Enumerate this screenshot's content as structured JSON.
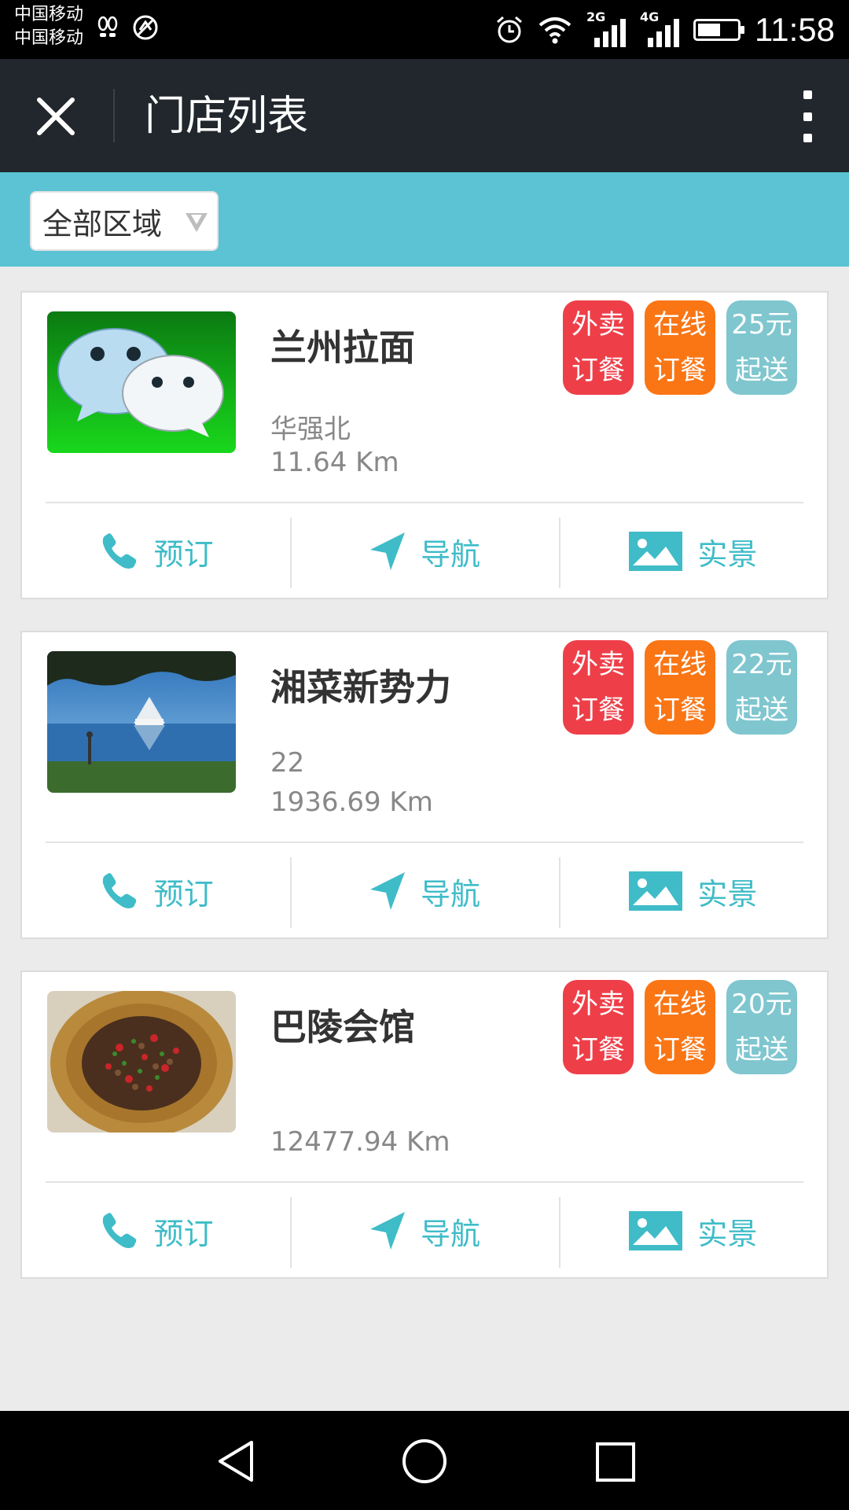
{
  "status_bar": {
    "carrier1": "中国移动",
    "carrier2": "中国移动",
    "network1": "2G",
    "network2": "4G",
    "time": "11:58",
    "icons": [
      "footprint-icon",
      "sync-icon",
      "alarm-icon",
      "wifi-icon",
      "signal-icon",
      "battery-icon"
    ]
  },
  "header": {
    "title": "门店列表",
    "close_icon": "close-icon",
    "more_icon": "more-vertical-icon"
  },
  "filter": {
    "region_label": "全部区域"
  },
  "colors": {
    "header_bg": "#21272c",
    "filter_bg": "#5bc3d4",
    "accent": "#3fbcc8",
    "tag_red": "#ee3f49",
    "tag_orange": "#fa7615",
    "tag_teal": "#7fc6cf"
  },
  "stores": [
    {
      "name": "兰州拉面",
      "address": "华强北",
      "distance": "11.64 Km",
      "image": "wechat-logo",
      "tags": [
        {
          "line1": "外卖",
          "line2": "订餐"
        },
        {
          "line1": "在线",
          "line2": "订餐"
        },
        {
          "line1": "25元",
          "line2": "起送"
        }
      ],
      "actions": {
        "reserve": "预订",
        "navigate": "导航",
        "scene": "实景"
      }
    },
    {
      "name": "湘菜新势力",
      "address": "22",
      "distance": "1936.69 Km",
      "image": "lake-pavilion-photo",
      "tags": [
        {
          "line1": "外卖",
          "line2": "订餐"
        },
        {
          "line1": "在线",
          "line2": "订餐"
        },
        {
          "line1": "22元",
          "line2": "起送"
        }
      ],
      "actions": {
        "reserve": "预订",
        "navigate": "导航",
        "scene": "实景"
      }
    },
    {
      "name": "巴陵会馆",
      "address": "",
      "distance": "12477.94 Km",
      "image": "stir-fry-dish-photo",
      "tags": [
        {
          "line1": "外卖",
          "line2": "订餐"
        },
        {
          "line1": "在线",
          "line2": "订餐"
        },
        {
          "line1": "20元",
          "line2": "起送"
        }
      ],
      "actions": {
        "reserve": "预订",
        "navigate": "导航",
        "scene": "实景"
      }
    }
  ],
  "nav_bar": {
    "icons": [
      "back-icon",
      "home-icon",
      "recents-icon"
    ]
  }
}
